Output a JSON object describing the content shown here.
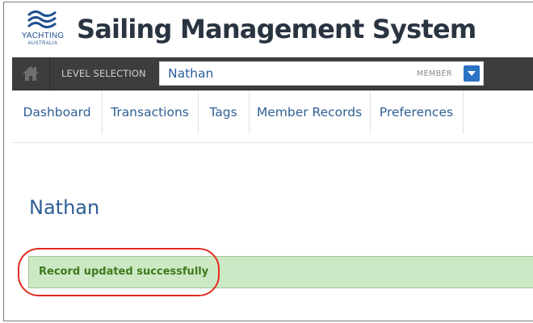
{
  "branding": {
    "logo_text": "YACHTING",
    "logo_subtext": "AUSTRALIA",
    "app_title": "Sailing Management System",
    "brand_color": "#1e4f8f"
  },
  "level_selection": {
    "label": "LEVEL SELECTION",
    "value": "Nathan",
    "type": "MEMBER"
  },
  "nav": {
    "items": [
      {
        "label": "Dashboard"
      },
      {
        "label": "Transactions"
      },
      {
        "label": "Tags"
      },
      {
        "label": "Member Records"
      },
      {
        "label": "Preferences"
      }
    ]
  },
  "main": {
    "title": "Nathan",
    "alert": {
      "message": "Record updated successfully",
      "color": "#3d7a1c",
      "background": "#cde8c4"
    },
    "highlight_color": "#e02b1f"
  }
}
